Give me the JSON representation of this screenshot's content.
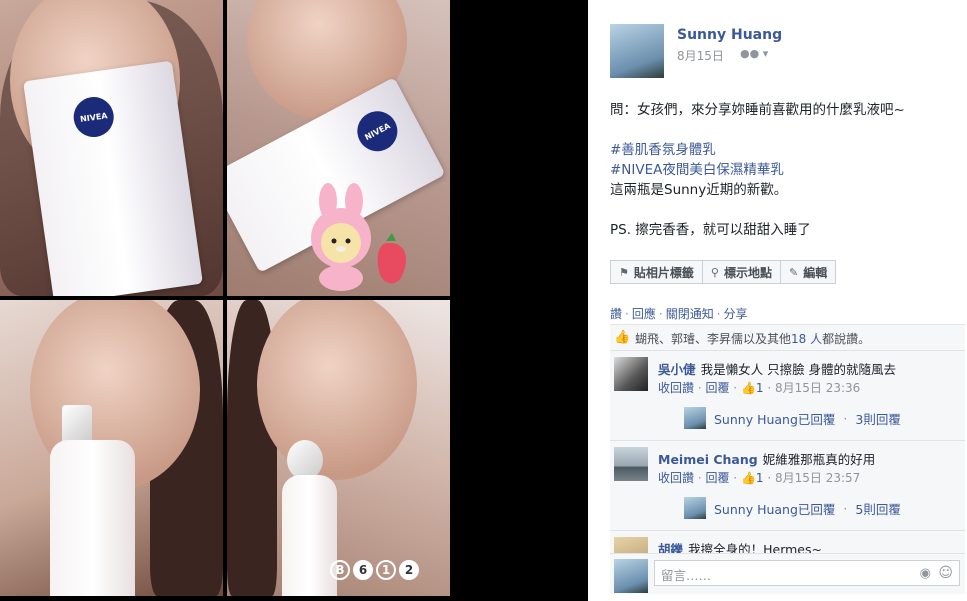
{
  "photo_viewer": {
    "counters": [
      "B",
      "6",
      "1",
      "2"
    ]
  },
  "post": {
    "author": "Sunny Huang",
    "date": "8月15日",
    "audience_icon": "friends-icon",
    "lines": [
      {
        "text": "問：女孩們，來分享妳睡前喜歡用的什麼乳液吧~",
        "kind": "text"
      },
      {
        "text": "",
        "kind": "gap"
      },
      {
        "text": "#善肌香氛身體乳",
        "kind": "tag"
      },
      {
        "text": "#NIVEA夜間美白保濕精華乳",
        "kind": "tag"
      },
      {
        "text": "這兩瓶是Sunny近期的新歡。",
        "kind": "text"
      },
      {
        "text": "",
        "kind": "gap"
      },
      {
        "text": "PS. 擦完香香，就可以甜甜入睡了",
        "kind": "text"
      }
    ],
    "buttons": {
      "tag_photo": "貼相片標籤",
      "add_location": "標示地點",
      "edit": "編輯"
    },
    "actions": [
      "讚",
      "回應",
      "關閉通知",
      "分享"
    ]
  },
  "likes": {
    "text_prefix": "蝴飛、郭璿、李昇儒以及其他 ",
    "count": "18 人",
    "text_suffix": "都說讚。"
  },
  "comments": [
    {
      "name": "吳小倢",
      "text": "我是懶女人 只擦臉 身體的就隨風去",
      "unlike": "收回讚",
      "reply": "回覆",
      "likes": "1",
      "time": "8月15日 23:36",
      "reply_summary": {
        "author": "Sunny Huang已回覆",
        "count": "3則回覆"
      }
    },
    {
      "name": "Meimei Chang",
      "text": "妮維雅那瓶真的好用",
      "unlike": "收回讚",
      "reply": "回覆",
      "likes": "1",
      "time": "8月15日 23:57",
      "reply_summary": {
        "author": "Sunny Huang已回覆",
        "count": "5則回覆"
      }
    },
    {
      "name": "胡鑠",
      "text": "我擦全身的！Hermes~"
    }
  ],
  "compose": {
    "placeholder": "留言……"
  }
}
